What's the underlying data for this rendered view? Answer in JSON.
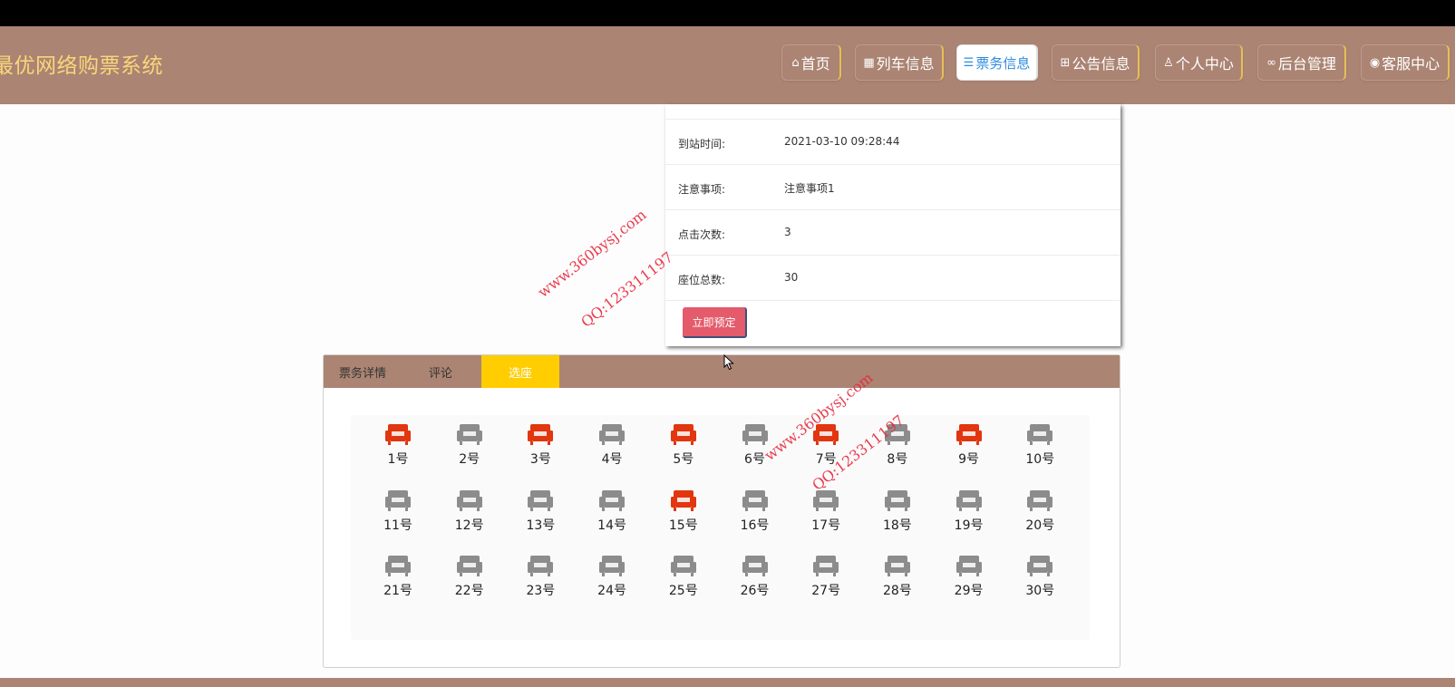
{
  "site": {
    "title": "最优网络购票系统"
  },
  "nav": {
    "items": [
      {
        "label": "首页",
        "icon": "home-icon"
      },
      {
        "label": "列车信息",
        "icon": "grid-icon"
      },
      {
        "label": "票务信息",
        "icon": "sliders-icon",
        "active": true
      },
      {
        "label": "公告信息",
        "icon": "gift-icon"
      },
      {
        "label": "个人中心",
        "icon": "user-icon"
      },
      {
        "label": "后台管理",
        "icon": "link-icon"
      },
      {
        "label": "客服中心",
        "icon": "chat-icon"
      }
    ]
  },
  "detail": {
    "rows": [
      {
        "label": "到站时间:",
        "value": "2021-03-10 09:28:44"
      },
      {
        "label": "注意事项:",
        "value": "注意事项1"
      },
      {
        "label": "点击次数:",
        "value": "3"
      },
      {
        "label": "座位总数:",
        "value": "30"
      }
    ],
    "reserve_label": "立即预定"
  },
  "tabs": [
    {
      "label": "票务详情"
    },
    {
      "label": "评论"
    },
    {
      "label": "选座",
      "active": true
    }
  ],
  "seats": {
    "labels": [
      "1号",
      "2号",
      "3号",
      "4号",
      "5号",
      "6号",
      "7号",
      "8号",
      "9号",
      "10号",
      "11号",
      "12号",
      "13号",
      "14号",
      "15号",
      "16号",
      "17号",
      "18号",
      "19号",
      "20号",
      "21号",
      "22号",
      "23号",
      "24号",
      "25号",
      "26号",
      "27号",
      "28号",
      "29号",
      "30号"
    ],
    "booked": [
      1,
      3,
      5,
      7,
      9,
      15
    ],
    "booked_color": "#e1360f",
    "free_color": "#8c8c8c"
  },
  "watermarks": {
    "site": "www.360bysj.com",
    "qq": "QQ:123311197"
  },
  "colors": {
    "header": "#ab8473",
    "title": "#f9d67a",
    "active_tab": "#ffcd00",
    "reserve": "#e45b6c"
  }
}
